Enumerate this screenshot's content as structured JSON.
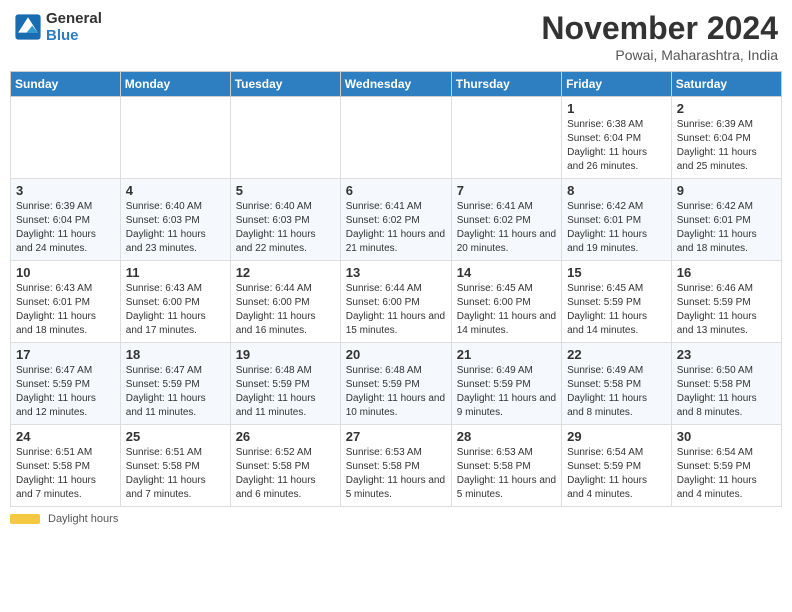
{
  "header": {
    "logo_line1": "General",
    "logo_line2": "Blue",
    "month_year": "November 2024",
    "location": "Powai, Maharashtra, India"
  },
  "weekdays": [
    "Sunday",
    "Monday",
    "Tuesday",
    "Wednesday",
    "Thursday",
    "Friday",
    "Saturday"
  ],
  "weeks": [
    [
      {
        "day": "",
        "info": ""
      },
      {
        "day": "",
        "info": ""
      },
      {
        "day": "",
        "info": ""
      },
      {
        "day": "",
        "info": ""
      },
      {
        "day": "",
        "info": ""
      },
      {
        "day": "1",
        "info": "Sunrise: 6:38 AM\nSunset: 6:04 PM\nDaylight: 11 hours and 26 minutes."
      },
      {
        "day": "2",
        "info": "Sunrise: 6:39 AM\nSunset: 6:04 PM\nDaylight: 11 hours and 25 minutes."
      }
    ],
    [
      {
        "day": "3",
        "info": "Sunrise: 6:39 AM\nSunset: 6:04 PM\nDaylight: 11 hours and 24 minutes."
      },
      {
        "day": "4",
        "info": "Sunrise: 6:40 AM\nSunset: 6:03 PM\nDaylight: 11 hours and 23 minutes."
      },
      {
        "day": "5",
        "info": "Sunrise: 6:40 AM\nSunset: 6:03 PM\nDaylight: 11 hours and 22 minutes."
      },
      {
        "day": "6",
        "info": "Sunrise: 6:41 AM\nSunset: 6:02 PM\nDaylight: 11 hours and 21 minutes."
      },
      {
        "day": "7",
        "info": "Sunrise: 6:41 AM\nSunset: 6:02 PM\nDaylight: 11 hours and 20 minutes."
      },
      {
        "day": "8",
        "info": "Sunrise: 6:42 AM\nSunset: 6:01 PM\nDaylight: 11 hours and 19 minutes."
      },
      {
        "day": "9",
        "info": "Sunrise: 6:42 AM\nSunset: 6:01 PM\nDaylight: 11 hours and 18 minutes."
      }
    ],
    [
      {
        "day": "10",
        "info": "Sunrise: 6:43 AM\nSunset: 6:01 PM\nDaylight: 11 hours and 18 minutes."
      },
      {
        "day": "11",
        "info": "Sunrise: 6:43 AM\nSunset: 6:00 PM\nDaylight: 11 hours and 17 minutes."
      },
      {
        "day": "12",
        "info": "Sunrise: 6:44 AM\nSunset: 6:00 PM\nDaylight: 11 hours and 16 minutes."
      },
      {
        "day": "13",
        "info": "Sunrise: 6:44 AM\nSunset: 6:00 PM\nDaylight: 11 hours and 15 minutes."
      },
      {
        "day": "14",
        "info": "Sunrise: 6:45 AM\nSunset: 6:00 PM\nDaylight: 11 hours and 14 minutes."
      },
      {
        "day": "15",
        "info": "Sunrise: 6:45 AM\nSunset: 5:59 PM\nDaylight: 11 hours and 14 minutes."
      },
      {
        "day": "16",
        "info": "Sunrise: 6:46 AM\nSunset: 5:59 PM\nDaylight: 11 hours and 13 minutes."
      }
    ],
    [
      {
        "day": "17",
        "info": "Sunrise: 6:47 AM\nSunset: 5:59 PM\nDaylight: 11 hours and 12 minutes."
      },
      {
        "day": "18",
        "info": "Sunrise: 6:47 AM\nSunset: 5:59 PM\nDaylight: 11 hours and 11 minutes."
      },
      {
        "day": "19",
        "info": "Sunrise: 6:48 AM\nSunset: 5:59 PM\nDaylight: 11 hours and 11 minutes."
      },
      {
        "day": "20",
        "info": "Sunrise: 6:48 AM\nSunset: 5:59 PM\nDaylight: 11 hours and 10 minutes."
      },
      {
        "day": "21",
        "info": "Sunrise: 6:49 AM\nSunset: 5:59 PM\nDaylight: 11 hours and 9 minutes."
      },
      {
        "day": "22",
        "info": "Sunrise: 6:49 AM\nSunset: 5:58 PM\nDaylight: 11 hours and 8 minutes."
      },
      {
        "day": "23",
        "info": "Sunrise: 6:50 AM\nSunset: 5:58 PM\nDaylight: 11 hours and 8 minutes."
      }
    ],
    [
      {
        "day": "24",
        "info": "Sunrise: 6:51 AM\nSunset: 5:58 PM\nDaylight: 11 hours and 7 minutes."
      },
      {
        "day": "25",
        "info": "Sunrise: 6:51 AM\nSunset: 5:58 PM\nDaylight: 11 hours and 7 minutes."
      },
      {
        "day": "26",
        "info": "Sunrise: 6:52 AM\nSunset: 5:58 PM\nDaylight: 11 hours and 6 minutes."
      },
      {
        "day": "27",
        "info": "Sunrise: 6:53 AM\nSunset: 5:58 PM\nDaylight: 11 hours and 5 minutes."
      },
      {
        "day": "28",
        "info": "Sunrise: 6:53 AM\nSunset: 5:58 PM\nDaylight: 11 hours and 5 minutes."
      },
      {
        "day": "29",
        "info": "Sunrise: 6:54 AM\nSunset: 5:59 PM\nDaylight: 11 hours and 4 minutes."
      },
      {
        "day": "30",
        "info": "Sunrise: 6:54 AM\nSunset: 5:59 PM\nDaylight: 11 hours and 4 minutes."
      }
    ]
  ],
  "footer": {
    "bar_label": "Daylight hours"
  }
}
